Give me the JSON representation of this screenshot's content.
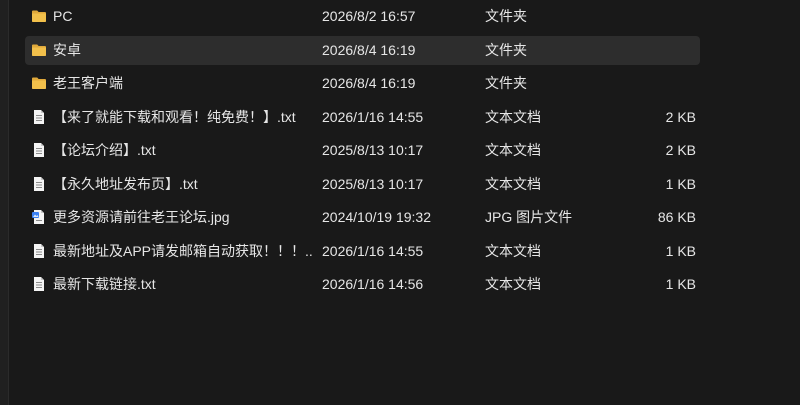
{
  "files": [
    {
      "name": "PC",
      "date": "2026/8/2 16:57",
      "type": "文件夹",
      "size": "",
      "icon": "folder-icon"
    },
    {
      "name": "安卓",
      "date": "2026/8/4 16:19",
      "type": "文件夹",
      "size": "",
      "icon": "folder-icon"
    },
    {
      "name": "老王客户端",
      "date": "2026/8/4 16:19",
      "type": "文件夹",
      "size": "",
      "icon": "folder-icon"
    },
    {
      "name": "【来了就能下载和观看！纯免费！】.txt",
      "date": "2026/1/16 14:55",
      "type": "文本文档",
      "size": "2 KB",
      "icon": "text-file-icon"
    },
    {
      "name": "【论坛介绍】.txt",
      "date": "2025/8/13 10:17",
      "type": "文本文档",
      "size": "2 KB",
      "icon": "text-file-icon"
    },
    {
      "name": "【永久地址发布页】.txt",
      "date": "2025/8/13 10:17",
      "type": "文本文档",
      "size": "1 KB",
      "icon": "text-file-icon"
    },
    {
      "name": "更多资源请前往老王论坛.jpg",
      "date": "2024/10/19 19:32",
      "type": "JPG 图片文件",
      "size": "86 KB",
      "icon": "image-file-icon"
    },
    {
      "name": "最新地址及APP请发邮箱自动获取！！！...",
      "date": "2026/1/16 14:55",
      "type": "文本文档",
      "size": "1 KB",
      "icon": "text-file-icon"
    },
    {
      "name": "最新下载链接.txt",
      "date": "2026/1/16 14:56",
      "type": "文本文档",
      "size": "1 KB",
      "icon": "text-file-icon"
    }
  ],
  "colors": {
    "background": "#191919",
    "selected_row": "#2d2d2d",
    "folder": "#f2c04b",
    "text": "#e6e6e6"
  }
}
